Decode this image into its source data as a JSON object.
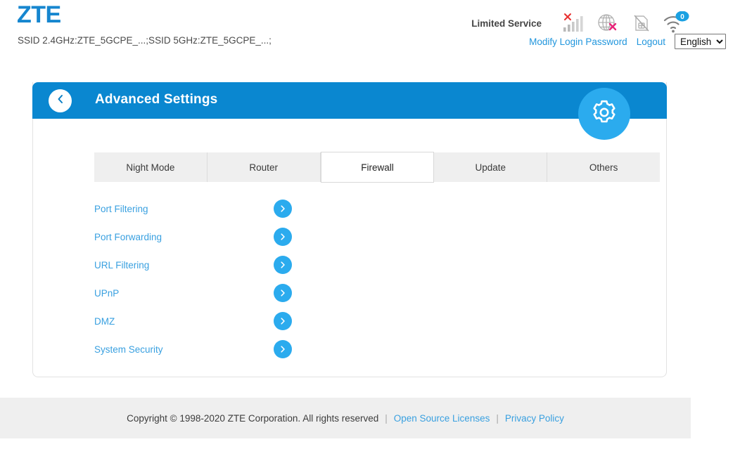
{
  "header": {
    "brand": "ZTE",
    "ssid_line": "SSID 2.4GHz:ZTE_5GCPE_...;SSID 5GHz:ZTE_5GCPE_...;",
    "service_status": "Limited Service",
    "icons": [
      {
        "name": "signal-bars-error-icon",
        "label": "Signal bars with error"
      },
      {
        "name": "globe-error-icon",
        "label": "Internet disconnected"
      },
      {
        "name": "sim-card-disabled-icon",
        "label": "SIM card unavailable"
      },
      {
        "name": "wifi-icon",
        "label": "Wi-Fi clients",
        "badge": "0"
      }
    ],
    "modify_password_label": "Modify Login Password",
    "logout_label": "Logout",
    "language": {
      "selected": "English",
      "options": [
        "English"
      ]
    }
  },
  "card": {
    "title": "Advanced Settings",
    "back_icon": "chevron-left-icon",
    "gear_icon": "gear-icon",
    "accent_color": "#0a87d0",
    "gear_circle_color": "#2babee"
  },
  "tabs": [
    {
      "label": "Night Mode",
      "active": false
    },
    {
      "label": "Router",
      "active": false
    },
    {
      "label": "Firewall",
      "active": true
    },
    {
      "label": "Update",
      "active": false
    },
    {
      "label": "Others",
      "active": false
    }
  ],
  "menu_items": [
    {
      "label": "Port Filtering"
    },
    {
      "label": "Port Forwarding"
    },
    {
      "label": "URL Filtering"
    },
    {
      "label": "UPnP"
    },
    {
      "label": "DMZ"
    },
    {
      "label": "System Security"
    }
  ],
  "footer": {
    "copyright": "Copyright © 1998-2020 ZTE Corporation. All rights reserved",
    "separator": "|",
    "open_source_label": "Open Source Licenses",
    "privacy_label": "Privacy Policy"
  },
  "colors": {
    "brand_blue": "#1686CF",
    "header_blue": "#0a87d0",
    "light_blue": "#2babee",
    "link_blue": "#39a0e0",
    "footer_bg": "#efefef",
    "error_red": "#e8302f",
    "badge_blue": "#1ba1e2"
  }
}
